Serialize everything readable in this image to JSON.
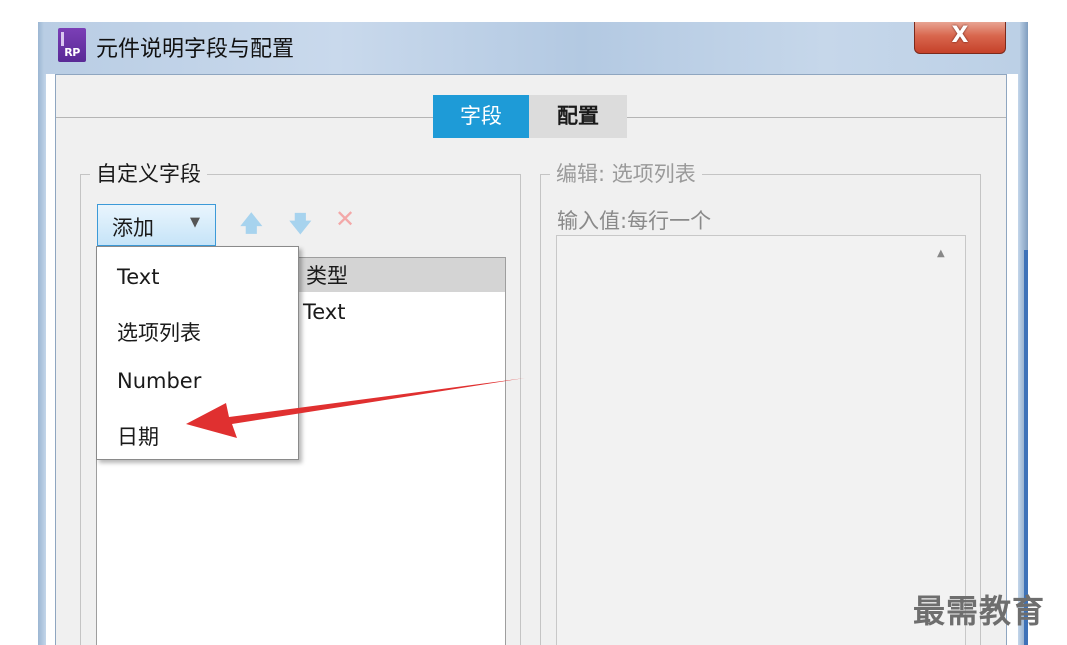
{
  "window": {
    "title": "元件说明字段与配置",
    "icon_text": "RP",
    "close_glyph": "X"
  },
  "tabs": [
    {
      "label": "字段",
      "active": true
    },
    {
      "label": "配置",
      "active": false
    }
  ],
  "custom_fields": {
    "group_label": "自定义字段",
    "add_button_label": "添加",
    "toolbar_icons": [
      "move-up-icon",
      "move-down-icon",
      "delete-icon"
    ],
    "columns": {
      "type": "类型"
    },
    "rows": [
      {
        "type": "Text"
      }
    ]
  },
  "add_menu": {
    "items": [
      "Text",
      "选项列表",
      "Number",
      "日期"
    ]
  },
  "editor": {
    "group_label": "编辑: 选项列表",
    "input_label": "输入值:每行一个"
  },
  "annotation": {
    "type": "red-arrow",
    "points_to": "日期"
  },
  "watermark": "最需教育",
  "colors": {
    "tab_active": "#1e9bd7",
    "close_button": "#c5412a",
    "arrow": "#e03030"
  }
}
